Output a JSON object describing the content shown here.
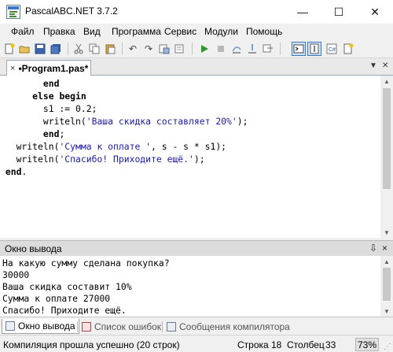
{
  "window": {
    "title": "PascalABC.NET 3.7.2",
    "minimize": "—",
    "maximize": "☐",
    "close": "✕"
  },
  "menu": [
    "Файл",
    "Правка",
    "Вид",
    "Программа",
    "Сервис",
    "Модули",
    "Помощь"
  ],
  "toolbar": {
    "icons": [
      "new-file-icon",
      "open-icon",
      "save-icon",
      "save-all-icon",
      "cut-icon",
      "copy-icon",
      "paste-icon",
      "undo-icon",
      "redo-icon",
      "build-icon",
      "run-icon",
      "stop-icon",
      "step-over-icon",
      "step-into-icon",
      "console-icon",
      "output-format-icon",
      "code-insight-icon",
      "new-document-icon"
    ]
  },
  "editor": {
    "tab_label": "•Program1.pas*",
    "tab_close": "×",
    "code": [
      {
        "segments": [
          {
            "t": "        "
          },
          {
            "t": "end",
            "k": "kw"
          }
        ]
      },
      {
        "segments": [
          {
            "t": "      "
          },
          {
            "t": "else begin",
            "k": "kw"
          }
        ]
      },
      {
        "segments": [
          {
            "t": "        s1 := 0.2;"
          }
        ]
      },
      {
        "segments": [
          {
            "t": "        writeln("
          },
          {
            "t": "'Ваша скидка составляет 20%'",
            "k": "str"
          },
          {
            "t": ");"
          }
        ]
      },
      {
        "segments": [
          {
            "t": "        "
          },
          {
            "t": "end",
            "k": "kw"
          },
          {
            "t": ";"
          }
        ]
      },
      {
        "segments": [
          {
            "t": "   writeln("
          },
          {
            "t": "'Сумма к оплате '",
            "k": "str"
          },
          {
            "t": ", s - s * s1);"
          }
        ]
      },
      {
        "segments": [
          {
            "t": "   writeln("
          },
          {
            "t": "'Спасибо! Приходите ещё.'",
            "k": "str"
          },
          {
            "t": ");"
          }
        ]
      },
      {
        "segments": [
          {
            "t": " "
          },
          {
            "t": "end",
            "k": "kw"
          },
          {
            "t": "."
          }
        ]
      }
    ]
  },
  "output_panel": {
    "title": "Окно вывода",
    "pin": "⇩",
    "close": "×",
    "lines": [
      "На какую сумму сделана покупка?",
      "30000",
      "Ваша скидка составит 10%",
      "Сумма к оплате 27000",
      "Спасибо! Приходите ещё."
    ]
  },
  "bottom_tabs": [
    {
      "label": "Окно вывода",
      "icon": "output-window-icon"
    },
    {
      "label": "Список ошибок",
      "icon": "error-list-icon"
    },
    {
      "label": "Сообщения компилятора",
      "icon": "compiler-messages-icon"
    }
  ],
  "status": {
    "message": "Компиляция прошла успешно (20 строк)",
    "line_label": "Строка",
    "line_value": "18",
    "col_label": "Столбец",
    "col_value": "33",
    "zoom": "73%"
  },
  "colors": {
    "string": "#1a1aa6",
    "toggle_highlight": "#cfe3fb"
  }
}
